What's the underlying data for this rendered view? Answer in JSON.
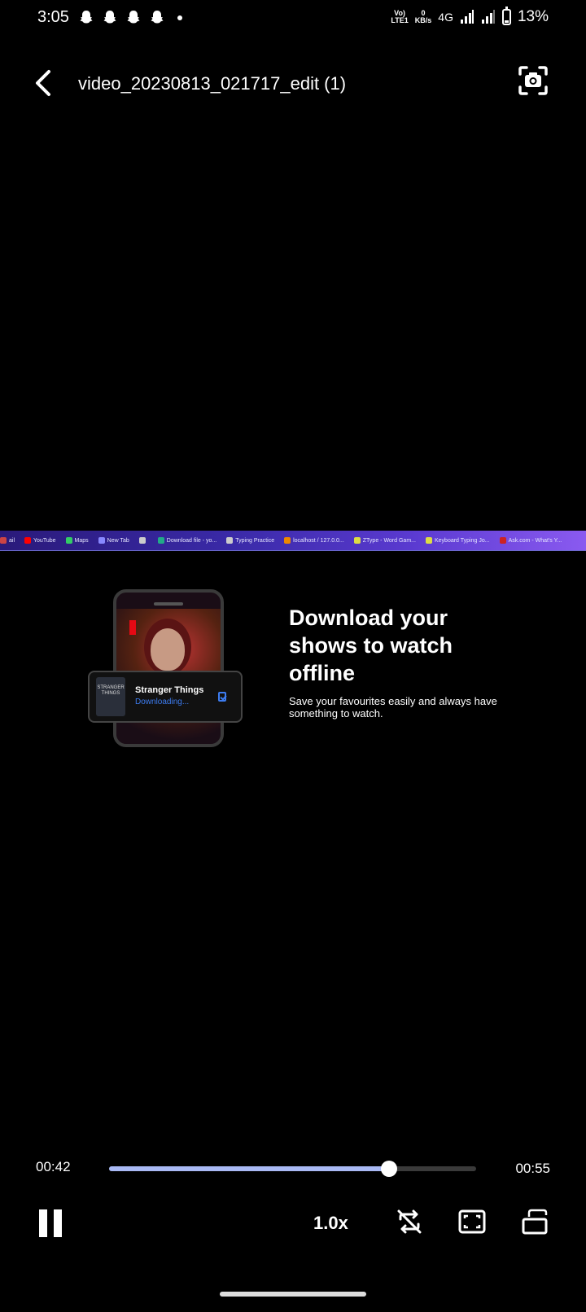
{
  "status_bar": {
    "time": "3:05",
    "volte_top": "Vo)",
    "volte_bottom": "LTE1",
    "speed_top": "0",
    "speed_bottom": "KB/s",
    "network": "4G",
    "battery": "13%",
    "notification_icons": [
      "snapchat-icon",
      "snapchat-icon",
      "snapchat-icon",
      "snapchat-icon"
    ]
  },
  "header": {
    "title": "video_20230813_021717_edit (1)"
  },
  "video": {
    "bookmarks": [
      {
        "label": "ail",
        "color": "#c44"
      },
      {
        "label": "YouTube",
        "color": "#f00"
      },
      {
        "label": "Maps",
        "color": "#3c6"
      },
      {
        "label": "New Tab",
        "color": "#88f"
      },
      {
        "label": "",
        "color": "#ccc"
      },
      {
        "label": "Download file - yo...",
        "color": "#2a8"
      },
      {
        "label": "Typing Practice",
        "color": "#ccc"
      },
      {
        "label": "localhost / 127.0.0...",
        "color": "#e80"
      },
      {
        "label": "ZType - Word Gam...",
        "color": "#dd4"
      },
      {
        "label": "Keyboard Typing Jo...",
        "color": "#dd4"
      },
      {
        "label": "Ask.com - What's Y...",
        "color": "#c22"
      }
    ],
    "card_thumb_text": "STRANGER THINGS",
    "card_title": "Stranger Things",
    "card_status": "Downloading...",
    "headline": "Download your shows to watch offline",
    "subtext": "Save your favourites easily and always have something to watch."
  },
  "player": {
    "current_time": "00:42",
    "total_time": "00:55",
    "progress": 0.763,
    "speed": "1.0x",
    "accent_color": "#a9b9f4"
  }
}
